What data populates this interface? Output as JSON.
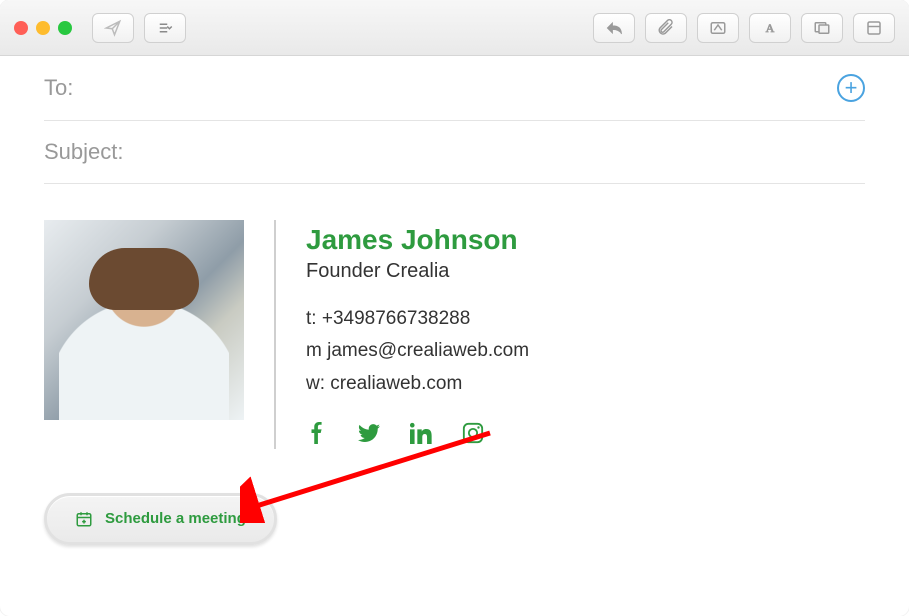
{
  "fields": {
    "to_label": "To:",
    "subject_label": "Subject:"
  },
  "signature": {
    "name": "James Johnson",
    "title": "Founder Crealia",
    "phone_prefix": "t: ",
    "phone": "+3498766738288",
    "email_prefix": "m ",
    "email": "james@crealiaweb.com",
    "web_prefix": "w: ",
    "web": "crealiaweb.com"
  },
  "cta": {
    "label": "Schedule a meeting"
  }
}
